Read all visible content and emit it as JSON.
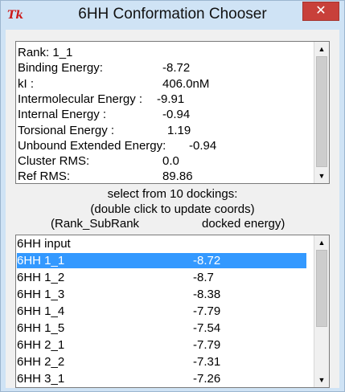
{
  "window": {
    "title": "6HH Conformation Chooser",
    "icon_glyph": "Tk",
    "close_glyph": "✕"
  },
  "info": {
    "rows": [
      {
        "label": "Rank: 1_1",
        "value": ""
      },
      {
        "label": "Binding Energy:",
        "value": "-8.72"
      },
      {
        "label": "kI :",
        "value": "406.0nM"
      },
      {
        "label": "Intermolecular Energy :",
        "value": "-9.91"
      },
      {
        "label": "Internal Energy :",
        "value": "-0.94"
      },
      {
        "label": "Torsional Energy :",
        "value": "1.19"
      },
      {
        "label": "Unbound Extended Energy:",
        "value": "-0.94"
      },
      {
        "label": "Cluster RMS:",
        "value": "0.0"
      },
      {
        "label": "Ref RMS:",
        "value": "89.86"
      }
    ]
  },
  "instructions": {
    "line1": "select from 10 dockings:",
    "line2": "(double click to update coords)",
    "col_rank": "(Rank_SubRank",
    "col_energy": "docked energy)"
  },
  "dockings": {
    "rows": [
      {
        "name": "6HH input",
        "energy": ""
      },
      {
        "name": "6HH 1_1",
        "energy": "-8.72"
      },
      {
        "name": "6HH 1_2",
        "energy": "-8.7"
      },
      {
        "name": "6HH 1_3",
        "energy": "-8.38"
      },
      {
        "name": "6HH 1_4",
        "energy": "-7.79"
      },
      {
        "name": "6HH 1_5",
        "energy": "-7.54"
      },
      {
        "name": "6HH 2_1",
        "energy": "-7.79"
      },
      {
        "name": "6HH 2_2",
        "energy": "-7.31"
      },
      {
        "name": "6HH 3_1",
        "energy": "-7.26"
      }
    ],
    "selected_index": 1
  },
  "scrollbar": {
    "up_glyph": "▲",
    "down_glyph": "▼"
  }
}
